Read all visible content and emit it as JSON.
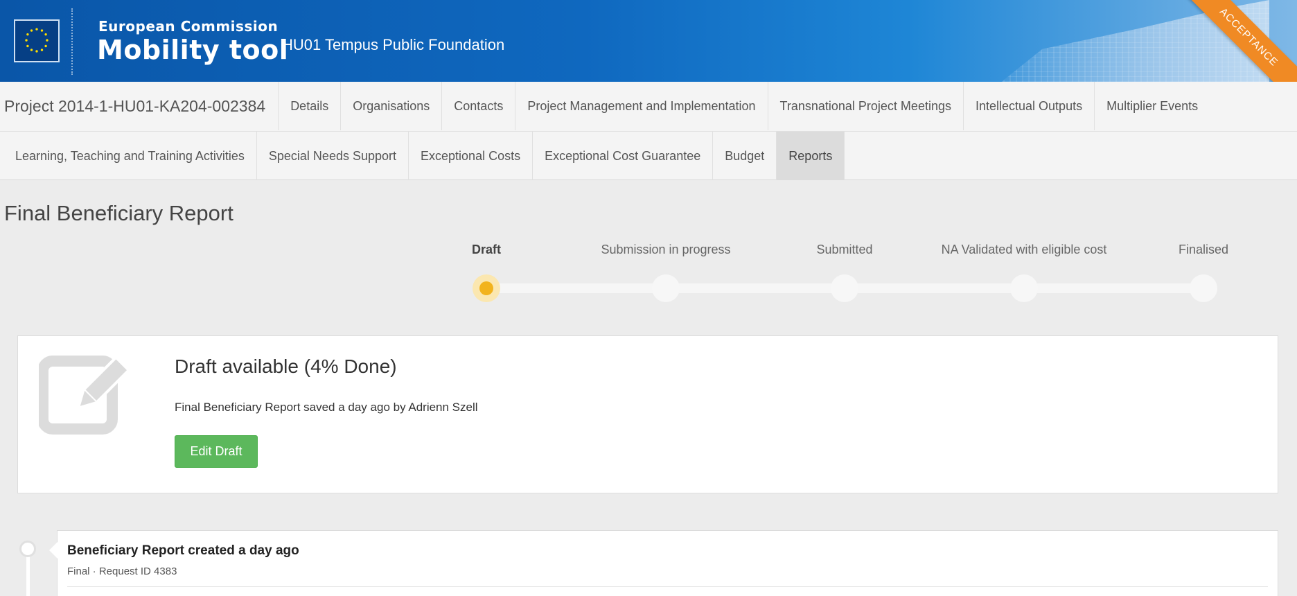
{
  "header": {
    "brand_top": "European Commission",
    "brand_main": "Mobility tool",
    "organisation": "HU01 Tempus Public Foundation",
    "environment_ribbon": "ACCEPTANCE",
    "colors": {
      "primary": "#0f68bf",
      "ribbon": "#f08a24"
    }
  },
  "nav": {
    "project_title": "Project 2014-1-HU01-KA204-002384",
    "row1": [
      {
        "label": "Details"
      },
      {
        "label": "Organisations"
      },
      {
        "label": "Contacts"
      },
      {
        "label": "Project Management and Implementation"
      },
      {
        "label": "Transnational Project Meetings"
      },
      {
        "label": "Intellectual Outputs"
      },
      {
        "label": "Multiplier Events"
      }
    ],
    "row2": [
      {
        "label": "Learning, Teaching and Training Activities"
      },
      {
        "label": "Special Needs Support"
      },
      {
        "label": "Exceptional Costs"
      },
      {
        "label": "Exceptional Cost Guarantee"
      },
      {
        "label": "Budget"
      },
      {
        "label": "Reports",
        "active": true
      }
    ]
  },
  "page": {
    "title": "Final Beneficiary Report"
  },
  "stepper": {
    "steps": [
      {
        "label": "Draft",
        "current": true
      },
      {
        "label": "Submission in progress"
      },
      {
        "label": "Submitted"
      },
      {
        "label": "NA Validated with eligible cost"
      },
      {
        "label": "Finalised"
      }
    ],
    "current_color": "#f2b31d"
  },
  "draft_card": {
    "icon": "edit-icon",
    "title": "Draft available (4% Done)",
    "subtitle": "Final Beneficiary Report saved a day ago by Adrienn Szell",
    "button_label": "Edit Draft",
    "button_color": "#5cb85c"
  },
  "timeline": {
    "items": [
      {
        "title": "Beneficiary Report created a day ago",
        "meta": "Final · Request ID 4383"
      }
    ]
  }
}
